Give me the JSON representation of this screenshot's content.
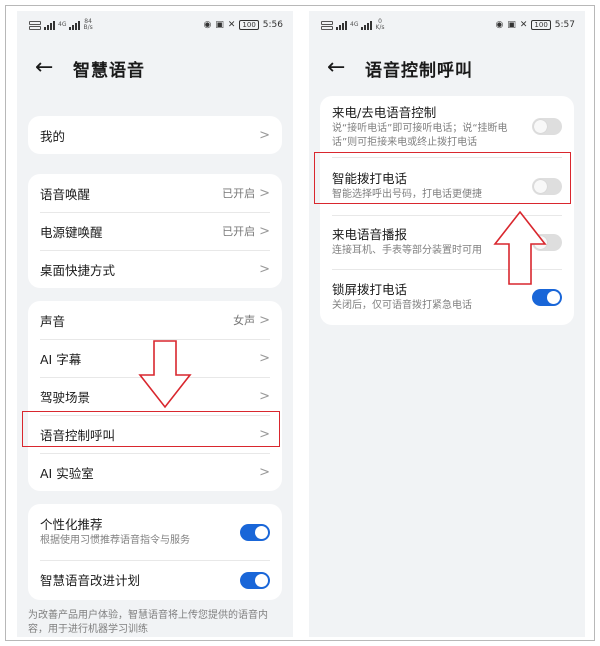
{
  "status_left": {
    "time": "5:56",
    "speed": "84",
    "speed_unit": "B/s",
    "network_label": "4G",
    "battery": "100"
  },
  "status_right": {
    "time": "5:57",
    "speed": "0",
    "speed_unit": "K/s",
    "network_label": "4G",
    "battery": "100"
  },
  "left_screen": {
    "title": "智慧语音",
    "groups": [
      {
        "items": [
          {
            "label": "我的",
            "value": ""
          }
        ]
      },
      {
        "items": [
          {
            "label": "语音唤醒",
            "value": "已开启"
          },
          {
            "label": "电源键唤醒",
            "value": "已开启"
          },
          {
            "label": "桌面快捷方式",
            "value": ""
          }
        ]
      },
      {
        "items": [
          {
            "label": "声音",
            "value": "女声"
          },
          {
            "label": "AI 字幕",
            "value": ""
          },
          {
            "label": "驾驶场景",
            "value": ""
          },
          {
            "label": "语音控制呼叫",
            "value": ""
          },
          {
            "label": "AI 实验室",
            "value": ""
          }
        ]
      }
    ],
    "toggles": [
      {
        "title": "个性化推荐",
        "desc": "根据使用习惯推荐语音指令与服务",
        "on": true
      },
      {
        "title": "智慧语音改进计划",
        "desc": "",
        "on": true
      }
    ],
    "footnote": "为改善产品用户体验，智慧语音将上传您提供的语音内容，用于进行机器学习训练"
  },
  "right_screen": {
    "title": "语音控制呼叫",
    "toggles": [
      {
        "title": "来电/去电语音控制",
        "desc": "说“接听电话”即可接听电话；说“挂断电话”则可拒接来电或终止拨打电话",
        "on": false
      },
      {
        "title": "智能拨打电话",
        "desc": "智能选择呼出号码，打电话更便捷",
        "on": false
      },
      {
        "title": "来电语音播报",
        "desc": "连接耳机、手表等部分装置时可用",
        "on": false
      },
      {
        "title": "锁屏拨打电话",
        "desc": "关闭后，仅可语音拨打紧急电话",
        "on": true
      }
    ]
  },
  "colors": {
    "accent": "#1966d8",
    "highlight": "#d9272e",
    "background": "#f1f3f5"
  },
  "icons": {
    "back": "arrow-left-icon",
    "chevron": "chevron-right-icon"
  }
}
